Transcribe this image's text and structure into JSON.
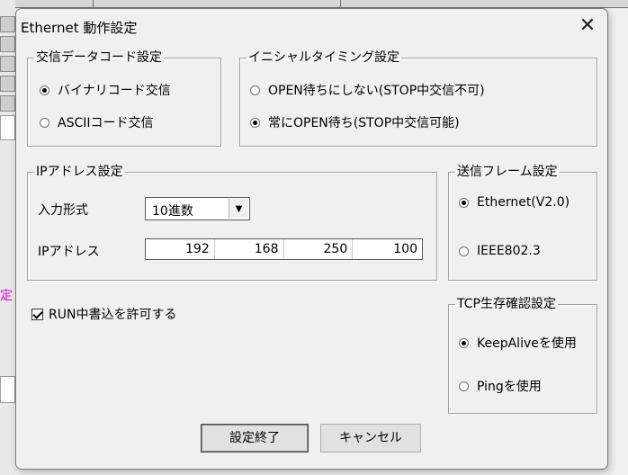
{
  "dialog": {
    "title": "Ethernet 動作設定",
    "close_symbol": "✕"
  },
  "comm_code": {
    "legend": "交信データコード設定",
    "options": [
      {
        "label": "バイナリコード交信",
        "selected": true
      },
      {
        "label": "ASCIIコード交信",
        "selected": false
      }
    ]
  },
  "initial_timing": {
    "legend": "イニシャルタイミング設定",
    "options": [
      {
        "label": "OPEN待ちにしない(STOP中交信不可)",
        "selected": false
      },
      {
        "label": "常にOPEN待ち(STOP中交信可能)",
        "selected": true
      }
    ]
  },
  "ip_settings": {
    "legend": "IPアドレス設定",
    "input_format_label": "入力形式",
    "input_format_value": "10進数",
    "ip_label": "IPアドレス",
    "ip_octets": [
      "192",
      "168",
      "250",
      "100"
    ]
  },
  "send_frame": {
    "legend": "送信フレーム設定",
    "options": [
      {
        "label": "Ethernet(V2.0)",
        "selected": true
      },
      {
        "label": "IEEE802.3",
        "selected": false
      }
    ]
  },
  "tcp_alive": {
    "legend": "TCP生存確認設定",
    "options": [
      {
        "label": "KeepAliveを使用",
        "selected": true
      },
      {
        "label": "Pingを使用",
        "selected": false
      }
    ]
  },
  "run_write": {
    "label": "RUN中書込を許可する",
    "checked": true
  },
  "buttons": {
    "ok": "設定終了",
    "cancel": "キャンセル"
  },
  "background": {
    "pink_text": "定"
  }
}
